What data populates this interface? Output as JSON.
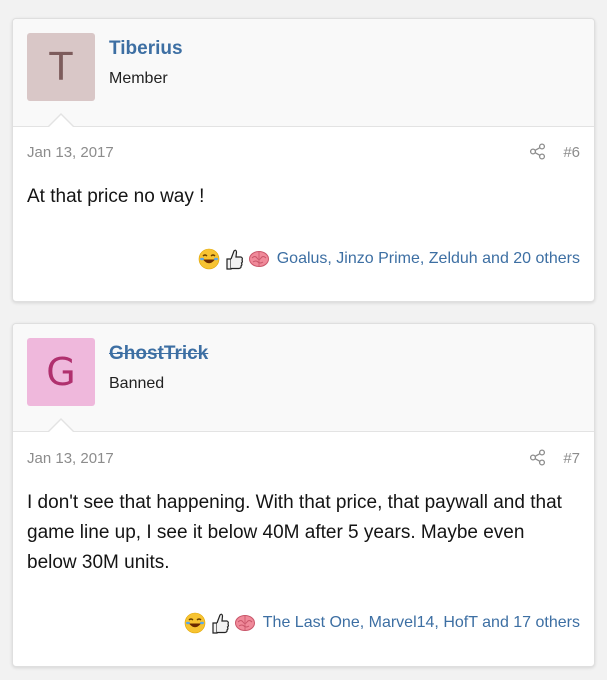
{
  "posts": [
    {
      "avatar_letter": "T",
      "avatar_bg": "#d9c7c7",
      "avatar_fg": "#7d5c5c",
      "username": "Tiberius",
      "user_title": "Member",
      "date": "Jan 13, 2017",
      "post_number": "#6",
      "message": "At that price no way !",
      "reactions_text": "Goalus, Jinzo Prime, Zelduh and 20 others"
    },
    {
      "avatar_letter": "G",
      "avatar_bg": "#efb8dc",
      "avatar_fg": "#b0306e",
      "username": "GhostTrick",
      "user_title": "Banned",
      "date": "Jan 13, 2017",
      "post_number": "#7",
      "message": "I don't see that happening. With that price, that paywall and that game line up, I see it below 40M after 5 years. Maybe even below 30M units.",
      "reactions_text": "The Last One, Marvel14, HofT and 17 others"
    }
  ],
  "reaction_icons": [
    "laughing-emoji-icon",
    "thumbs-up-icon",
    "brain-icon"
  ],
  "link_color": "#3d6fa3"
}
